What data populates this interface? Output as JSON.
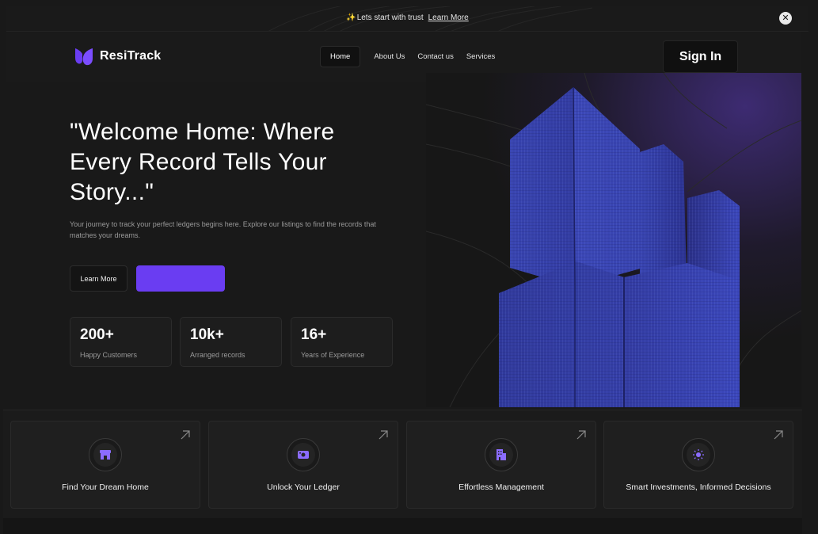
{
  "announcement": {
    "sparkle": "✨",
    "text": "Lets start with trust",
    "link_label": "Learn More",
    "close_glyph": "✕"
  },
  "brand": {
    "name": "ResiTrack",
    "accent_color": "#6a3df2"
  },
  "nav": {
    "items": [
      {
        "label": "Home",
        "active": true
      },
      {
        "label": "About Us",
        "active": false
      },
      {
        "label": "Contact us",
        "active": false
      },
      {
        "label": "Services",
        "active": false
      }
    ],
    "signin_label": "Sign In"
  },
  "hero": {
    "title": "\"Welcome Home: Where Every Record Tells Your Story...\"",
    "subtitle": "Your journey to track your perfect ledgers begins here. Explore our listings to find the records that matches your dreams.",
    "learn_more_label": "Learn More",
    "primary_button_label": "",
    "stats": [
      {
        "value": "200+",
        "label": "Happy Customers"
      },
      {
        "value": "10k+",
        "label": "Arranged records"
      },
      {
        "value": "16+",
        "label": "Years of Experience"
      }
    ]
  },
  "features": [
    {
      "label": "Find Your Dream Home",
      "icon": "storefront-icon"
    },
    {
      "label": "Unlock Your Ledger",
      "icon": "wallet-icon"
    },
    {
      "label": "Effortless  Management",
      "icon": "building-icon"
    },
    {
      "label": "Smart Investments, Informed Decisions",
      "icon": "sun-icon"
    }
  ]
}
